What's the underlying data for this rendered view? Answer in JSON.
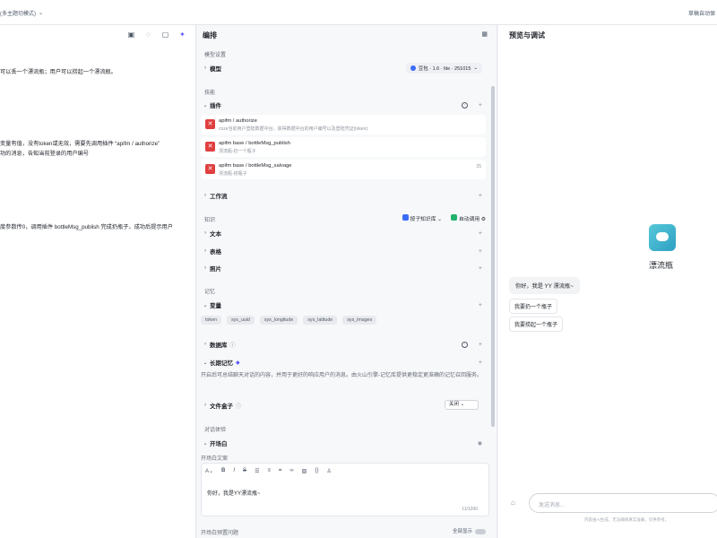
{
  "topbar": {
    "mode": "(多主题切模式)",
    "auto": "草稿自动保"
  },
  "prompt": {
    "lines": [
      "可以丢一个漂流瓶；用户可以捞起一个漂流瓶。",
      "变量有值，没有token或无效，需要先调用插件 “apifm / authorize”",
      "功的消息，告知当前登录的用户编号",
      "度参数传0，调用插件 bottleMsg_publish 完成扔瓶子，成功后提示用户"
    ]
  },
  "editor_panel": {
    "title": "编排",
    "model_section": "模型设置",
    "model_label": "模型",
    "model_value": "豆包 · 1.6 · lite · 251015",
    "skills_section": "技能",
    "plugins_label": "插件",
    "plugins": [
      {
        "name": "apifm / authorize",
        "desc": "coze当前用户登陆数据中台，获得数据中台的用户编号以及登陆凭证(token)",
        "count": ""
      },
      {
        "name": "apifm base / bottleMsg_publish",
        "desc": "漂流瓶-扔一个瓶子",
        "count": ""
      },
      {
        "name": "apifm base / bottleMsg_salvage",
        "desc": "漂流瓶-捞瓶子",
        "count": "25"
      }
    ],
    "workflow_label": "工作流",
    "knowledge_section": "知识",
    "knowledge_mode": "按子知识库",
    "knowledge_call": "自动调用",
    "text_label": "文本",
    "table_label": "表格",
    "photo_label": "照片",
    "memory_section": "记忆",
    "variables_label": "变量",
    "variable_tags": [
      "token",
      "sys_uuid",
      "sys_longitude",
      "sys_latitude",
      "sys_images"
    ],
    "database_label": "数据库",
    "longterm_label": "长期记忆",
    "longterm_note": "开启后可总结聊天对话的内容，并用于更好的响应用户的消息。由火山引擎-记忆库提供更稳定更准确的记忆召回服务。",
    "filebox_label": "文件盒子",
    "filebox_value": "关闭",
    "dialog_section": "对话体验",
    "opening_label": "开场白",
    "opening_text_label": "开场白文案",
    "opening_text": "你好，我是YY漂流瓶~",
    "counter": "11/1000",
    "opening_questions": "开场白预置问题",
    "show_all": "全部显示"
  },
  "preview": {
    "title": "预览与调试",
    "bot_name": "漂流瓶",
    "greeting": "你好，我是 YY 漂流瓶~",
    "suggestions": [
      "我要扔一个瓶子",
      "我要捞起一个瓶子"
    ],
    "input_placeholder": "发送消息...",
    "footnote": "内容由AI生成，无法确保真实准确，仅供参考。"
  }
}
